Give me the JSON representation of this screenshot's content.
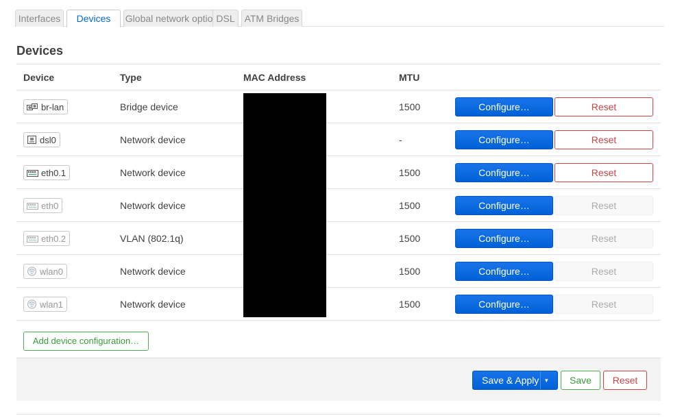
{
  "tabs": [
    {
      "label": "Interfaces"
    },
    {
      "label": "Devices"
    },
    {
      "label": "Global network options"
    },
    {
      "label": "DSL"
    },
    {
      "label": "ATM Bridges"
    }
  ],
  "active_tab": "Devices",
  "section": {
    "title": "Devices"
  },
  "table": {
    "headers": {
      "device": "Device",
      "type": "Type",
      "mac": "MAC Address",
      "mtu": "MTU"
    },
    "rows": [
      {
        "name": "br-lan",
        "type": "Bridge device",
        "mtu": "1500",
        "icon": "bridge-icon",
        "reset_enabled": true
      },
      {
        "name": "dsl0",
        "type": "Network device",
        "mtu": "-",
        "icon": "ethernet-icon",
        "reset_enabled": true
      },
      {
        "name": "eth0.1",
        "type": "Network device",
        "mtu": "1500",
        "icon": "switch-icon",
        "reset_enabled": true
      },
      {
        "name": "eth0",
        "type": "Network device",
        "mtu": "1500",
        "icon": "switch-icon",
        "reset_enabled": false
      },
      {
        "name": "eth0.2",
        "type": "VLAN (802.1q)",
        "mtu": "1500",
        "icon": "switch-icon",
        "reset_enabled": false
      },
      {
        "name": "wlan0",
        "type": "Network device",
        "mtu": "1500",
        "icon": "wifi-icon",
        "reset_enabled": false
      },
      {
        "name": "wlan1",
        "type": "Network device",
        "mtu": "1500",
        "icon": "wifi-icon",
        "reset_enabled": false
      }
    ],
    "configure_label": "Configure…",
    "reset_label": "Reset"
  },
  "add_device_label": "Add device configuration…",
  "footer": {
    "save_apply_label": "Save & Apply",
    "dropdown_caret": "▾",
    "save_label": "Save",
    "reset_label": "Reset"
  },
  "colors": {
    "primary": "#0069d6",
    "success": "#4cae4c",
    "danger": "#cc4444"
  }
}
